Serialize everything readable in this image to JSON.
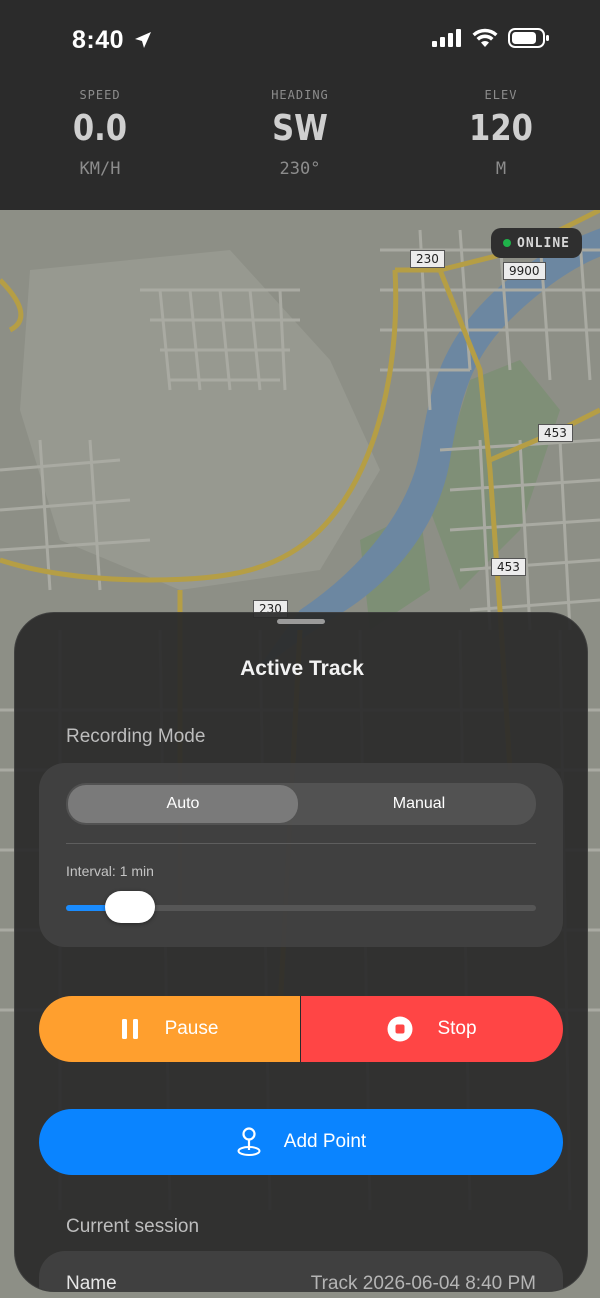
{
  "status_bar": {
    "time": "8:40"
  },
  "telemetry": [
    {
      "label": "SPEED",
      "value": "0.0",
      "unit": "KM/H"
    },
    {
      "label": "HEADING",
      "value": "SW",
      "unit": "230°"
    },
    {
      "label": "ELEV",
      "value": "120",
      "unit": "M"
    }
  ],
  "map": {
    "status": "ONLINE",
    "road_labels": [
      "230",
      "9900",
      "453",
      "453",
      "230"
    ]
  },
  "sheet": {
    "title": "Active Track",
    "recording_mode_label": "Recording Mode",
    "segments": [
      "Auto",
      "Manual"
    ],
    "selected_segment": "Auto",
    "interval_label": "Interval: 1 min",
    "interval_fraction": 0.09,
    "pause_label": "Pause",
    "stop_label": "Stop",
    "add_point_label": "Add Point",
    "current_session_label": "Current session",
    "session": {
      "name_label": "Name",
      "name_value": "Track 2026-06-04 8:40 PM"
    }
  },
  "colors": {
    "pause": "#ff9f2e",
    "stop": "#ff4545",
    "add_point": "#0a84ff",
    "online_dot": "#1fb34a"
  }
}
